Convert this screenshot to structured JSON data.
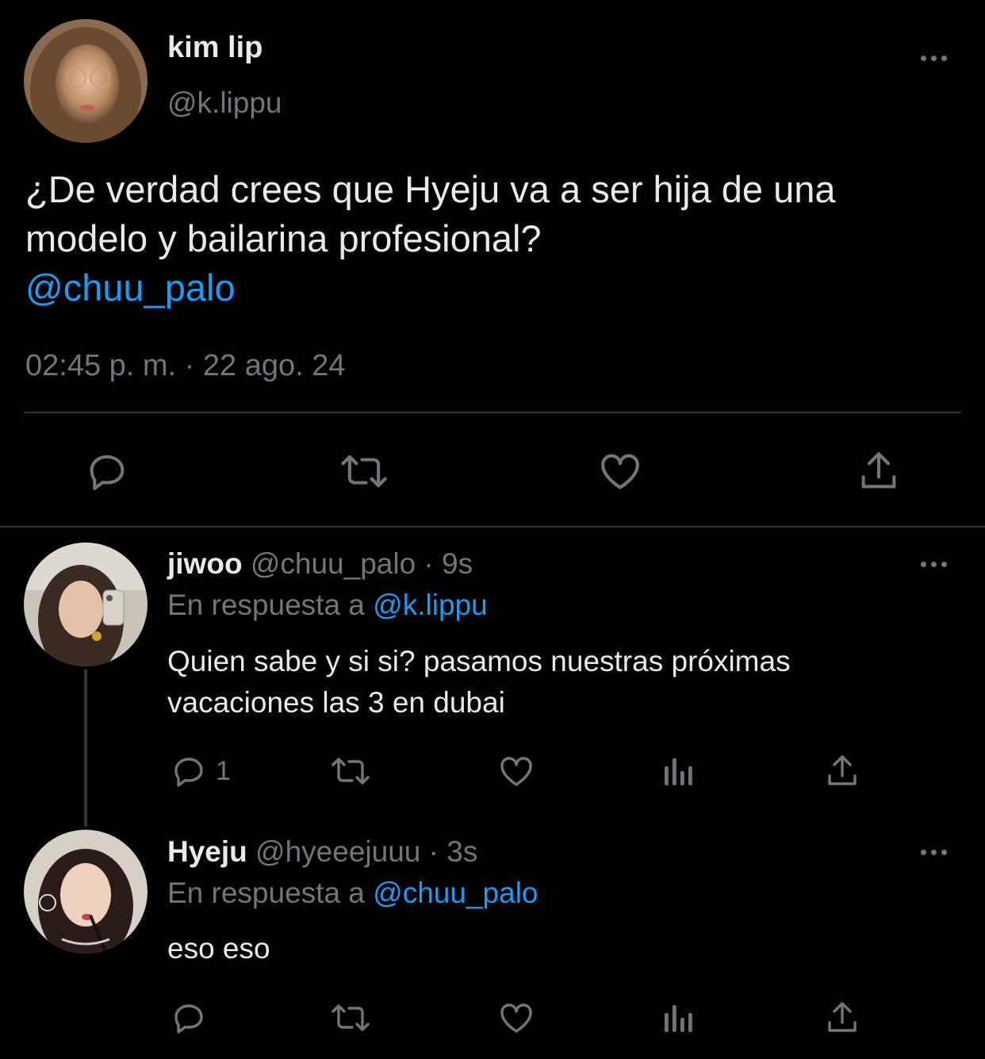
{
  "main_tweet": {
    "author_name": "kim lip",
    "handle": "@k.lippu",
    "text": "¿De verdad crees que Hyeju va a ser hija de una modelo y bailarina profesional?",
    "mention": "@chuu_palo",
    "timestamp": "02:45 p. m. · 22 ago. 24",
    "actions": [
      "reply-icon",
      "retweet-icon",
      "like-icon",
      "share-icon"
    ]
  },
  "replies": [
    {
      "author_name": "jiwoo",
      "handle_time": "@chuu_palo · 9s",
      "replying_prefix": "En respuesta a",
      "replying_to": "@k.lippu",
      "text_line1": "Quien sabe y si si? pasamos nuestras próximas",
      "text_line2": "vacaciones las 3 en dubai",
      "reply_count": "1",
      "actions": [
        "reply-icon",
        "retweet-icon",
        "like-icon",
        "views-icon",
        "share-icon"
      ]
    },
    {
      "author_name": "Hyeju",
      "handle_time": "@hyeeejuuu · 3s",
      "replying_prefix": "En respuesta a",
      "replying_to": "@chuu_palo",
      "text_line1": "eso eso",
      "reply_count": "",
      "actions": [
        "reply-icon",
        "retweet-icon",
        "like-icon",
        "views-icon",
        "share-icon"
      ]
    }
  ],
  "colors": {
    "background": "#000000",
    "text": "#e7e9ea",
    "secondary": "#71767b",
    "accent": "#1d9bf0",
    "divider": "#2f3336"
  }
}
